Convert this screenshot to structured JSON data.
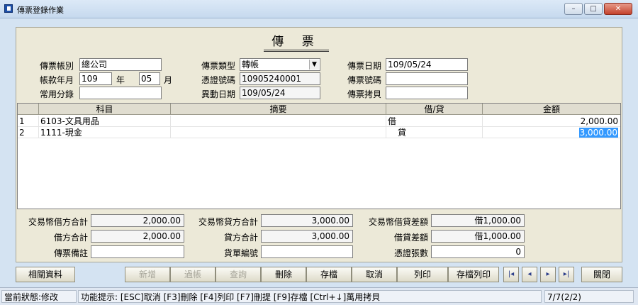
{
  "window": {
    "title": "傳票登錄作業",
    "minimize": "–",
    "maximize": "□",
    "close": "✕"
  },
  "doc_title": "傳 票",
  "header": {
    "account_label": "傳票帳別",
    "account_value": "總公司",
    "period_label": "帳款年月",
    "year_value": "109",
    "year_unit": "年",
    "month_value": "05",
    "month_unit": "月",
    "common_entry_label": "常用分錄",
    "common_entry_value": "",
    "type_label": "傳票類型",
    "type_value": "轉帳",
    "evidence_no_label": "憑證號碼",
    "evidence_no_value": "10905240001",
    "change_date_label": "異動日期",
    "change_date_value": "109/05/24",
    "voucher_date_label": "傳票日期",
    "voucher_date_value": "109/05/24",
    "voucher_no_label": "傳票號碼",
    "voucher_no_value": "",
    "copy_label": "傳票拷貝",
    "copy_value": ""
  },
  "grid": {
    "columns": [
      "科目",
      "摘要",
      "借/貸",
      "金額"
    ],
    "rows": [
      {
        "no": "1",
        "subject": "6103-文具用品",
        "summary": "",
        "dc": "借",
        "amount": "2,000.00"
      },
      {
        "no": "2",
        "subject": "1111-現金",
        "summary": "",
        "dc": "貸",
        "amount": "3,000.00"
      }
    ]
  },
  "totals": {
    "trade_debit_label": "交易幣借方合計",
    "trade_debit_value": "2,000.00",
    "trade_credit_label": "交易幣貸方合計",
    "trade_credit_value": "3,000.00",
    "trade_diff_label": "交易幣借貸差額",
    "trade_diff_value": "借1,000.00",
    "debit_label": "借方合計",
    "debit_value": "2,000.00",
    "credit_label": "貸方合計",
    "credit_value": "3,000.00",
    "diff_label": "借貸差額",
    "diff_value": "借1,000.00",
    "memo_label": "傳票備註",
    "memo_value": "",
    "goods_no_label": "貨單編號",
    "goods_no_value": "",
    "evidence_count_label": "憑證張數",
    "evidence_count_value": "0"
  },
  "buttons": {
    "related": "相關資料",
    "new": "新增",
    "post": "過帳",
    "query": "查詢",
    "delete": "刪除",
    "save": "存檔",
    "cancel": "取消",
    "print": "列印",
    "save_print": "存檔列印",
    "first": "|◂",
    "prev": "◂",
    "next": "▸",
    "last": "▸|",
    "close": "關閉"
  },
  "status": {
    "state": "當前狀態:修改",
    "hint": "功能提示: [ESC]取消 [F3]刪除 [F4]列印 [F7]刪提 [F9]存檔 [Ctrl+↓]萬用拷貝",
    "record": "7/7(2/2)"
  }
}
